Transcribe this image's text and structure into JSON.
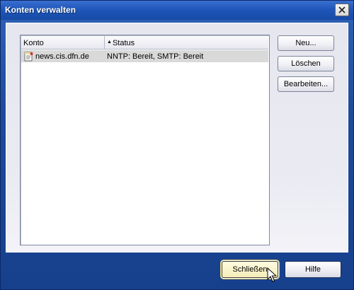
{
  "window": {
    "title": "Konten verwalten",
    "close_label": "close"
  },
  "list": {
    "columns": [
      {
        "label": "Konto",
        "sorted": false
      },
      {
        "label": "Status",
        "sorted": true,
        "sort_direction": "ascending"
      }
    ],
    "rows": [
      {
        "konto": "news.cis.dfn.de",
        "status": "NNTP: Bereit, SMTP: Bereit",
        "icon": "newsgroup-account-icon",
        "selected": true
      }
    ]
  },
  "side_buttons": {
    "new": "Neu...",
    "delete": "Löschen",
    "edit": "Bearbeiten..."
  },
  "footer_buttons": {
    "close": "Schließen",
    "help": "Hilfe"
  },
  "colors": {
    "titlebar": "#1f56b8",
    "client_bg": "#e9e9f1",
    "selected_row": "#d9d9d9",
    "default_button_bg": "#f6edb9"
  }
}
